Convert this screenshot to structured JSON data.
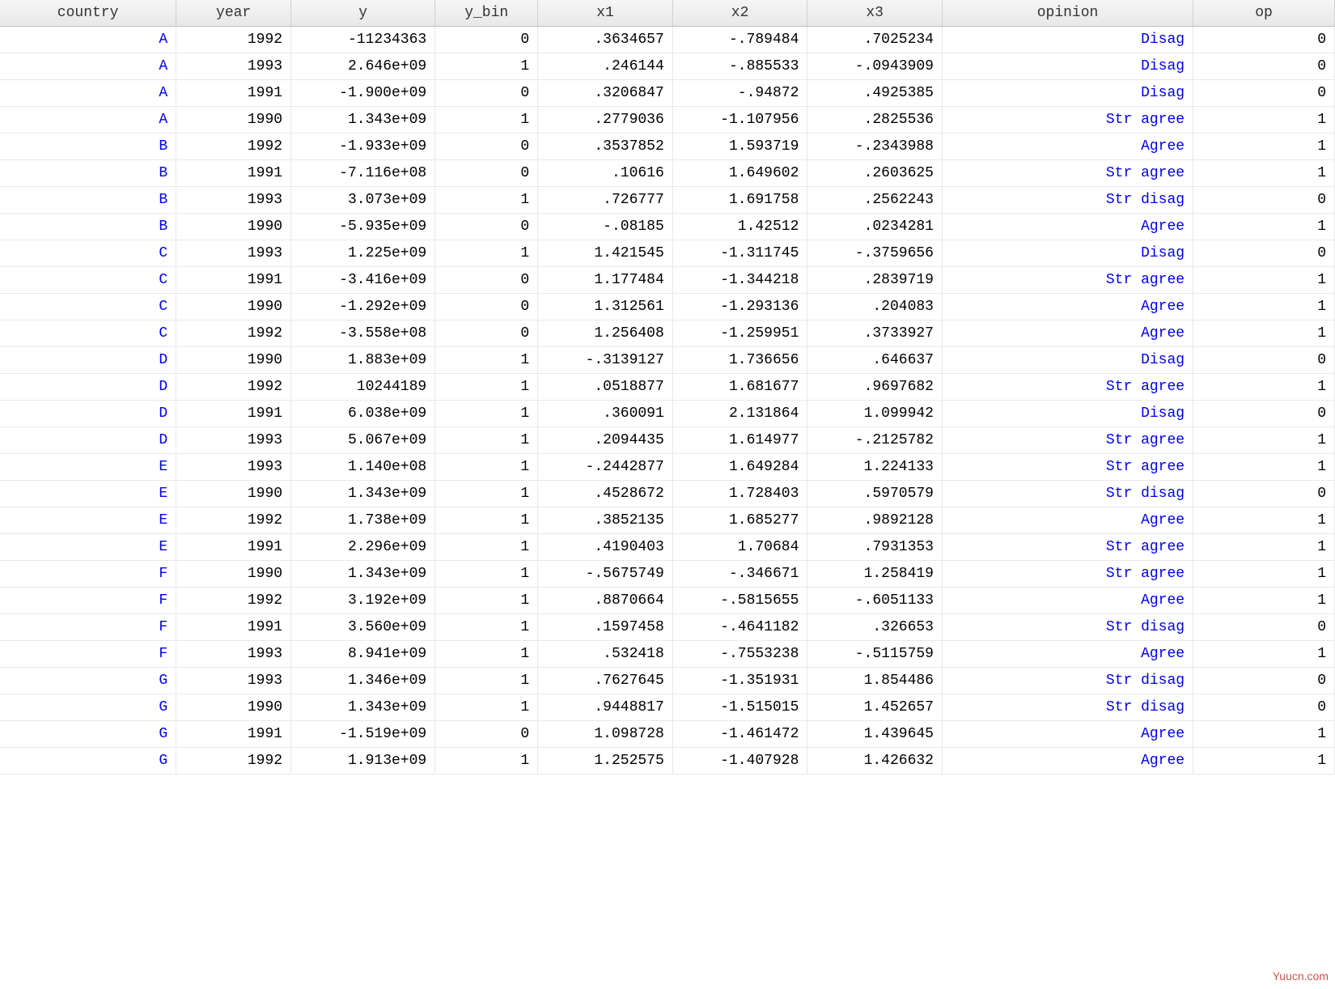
{
  "watermark": "Yuucn.com",
  "columns": [
    "country",
    "year",
    "y",
    "y_bin",
    "x1",
    "x2",
    "x3",
    "opinion",
    "op"
  ],
  "link_columns": [
    0,
    7
  ],
  "rows": [
    [
      "A",
      "1992",
      "-11234363",
      "0",
      ".3634657",
      "-.789484",
      ".7025234",
      "Disag",
      "0"
    ],
    [
      "A",
      "1993",
      "2.646e+09",
      "1",
      ".246144",
      "-.885533",
      "-.0943909",
      "Disag",
      "0"
    ],
    [
      "A",
      "1991",
      "-1.900e+09",
      "0",
      ".3206847",
      "-.94872",
      ".4925385",
      "Disag",
      "0"
    ],
    [
      "A",
      "1990",
      "1.343e+09",
      "1",
      ".2779036",
      "-1.107956",
      ".2825536",
      "Str agree",
      "1"
    ],
    [
      "B",
      "1992",
      "-1.933e+09",
      "0",
      ".3537852",
      "1.593719",
      "-.2343988",
      "Agree",
      "1"
    ],
    [
      "B",
      "1991",
      "-7.116e+08",
      "0",
      ".10616",
      "1.649602",
      ".2603625",
      "Str agree",
      "1"
    ],
    [
      "B",
      "1993",
      "3.073e+09",
      "1",
      ".726777",
      "1.691758",
      ".2562243",
      "Str disag",
      "0"
    ],
    [
      "B",
      "1990",
      "-5.935e+09",
      "0",
      "-.08185",
      "1.42512",
      ".0234281",
      "Agree",
      "1"
    ],
    [
      "C",
      "1993",
      "1.225e+09",
      "1",
      "1.421545",
      "-1.311745",
      "-.3759656",
      "Disag",
      "0"
    ],
    [
      "C",
      "1991",
      "-3.416e+09",
      "0",
      "1.177484",
      "-1.344218",
      ".2839719",
      "Str agree",
      "1"
    ],
    [
      "C",
      "1990",
      "-1.292e+09",
      "0",
      "1.312561",
      "-1.293136",
      ".204083",
      "Agree",
      "1"
    ],
    [
      "C",
      "1992",
      "-3.558e+08",
      "0",
      "1.256408",
      "-1.259951",
      ".3733927",
      "Agree",
      "1"
    ],
    [
      "D",
      "1990",
      "1.883e+09",
      "1",
      "-.3139127",
      "1.736656",
      ".646637",
      "Disag",
      "0"
    ],
    [
      "D",
      "1992",
      "10244189",
      "1",
      ".0518877",
      "1.681677",
      ".9697682",
      "Str agree",
      "1"
    ],
    [
      "D",
      "1991",
      "6.038e+09",
      "1",
      ".360091",
      "2.131864",
      "1.099942",
      "Disag",
      "0"
    ],
    [
      "D",
      "1993",
      "5.067e+09",
      "1",
      ".2094435",
      "1.614977",
      "-.2125782",
      "Str agree",
      "1"
    ],
    [
      "E",
      "1993",
      "1.140e+08",
      "1",
      "-.2442877",
      "1.649284",
      "1.224133",
      "Str agree",
      "1"
    ],
    [
      "E",
      "1990",
      "1.343e+09",
      "1",
      ".4528672",
      "1.728403",
      ".5970579",
      "Str disag",
      "0"
    ],
    [
      "E",
      "1992",
      "1.738e+09",
      "1",
      ".3852135",
      "1.685277",
      ".9892128",
      "Agree",
      "1"
    ],
    [
      "E",
      "1991",
      "2.296e+09",
      "1",
      ".4190403",
      "1.70684",
      ".7931353",
      "Str agree",
      "1"
    ],
    [
      "F",
      "1990",
      "1.343e+09",
      "1",
      "-.5675749",
      "-.346671",
      "1.258419",
      "Str agree",
      "1"
    ],
    [
      "F",
      "1992",
      "3.192e+09",
      "1",
      ".8870664",
      "-.5815655",
      "-.6051133",
      "Agree",
      "1"
    ],
    [
      "F",
      "1991",
      "3.560e+09",
      "1",
      ".1597458",
      "-.4641182",
      ".326653",
      "Str disag",
      "0"
    ],
    [
      "F",
      "1993",
      "8.941e+09",
      "1",
      ".532418",
      "-.7553238",
      "-.5115759",
      "Agree",
      "1"
    ],
    [
      "G",
      "1993",
      "1.346e+09",
      "1",
      ".7627645",
      "-1.351931",
      "1.854486",
      "Str disag",
      "0"
    ],
    [
      "G",
      "1990",
      "1.343e+09",
      "1",
      ".9448817",
      "-1.515015",
      "1.452657",
      "Str disag",
      "0"
    ],
    [
      "G",
      "1991",
      "-1.519e+09",
      "0",
      "1.098728",
      "-1.461472",
      "1.439645",
      "Agree",
      "1"
    ],
    [
      "G",
      "1992",
      "1.913e+09",
      "1",
      "1.252575",
      "-1.407928",
      "1.426632",
      "Agree",
      "1"
    ]
  ]
}
